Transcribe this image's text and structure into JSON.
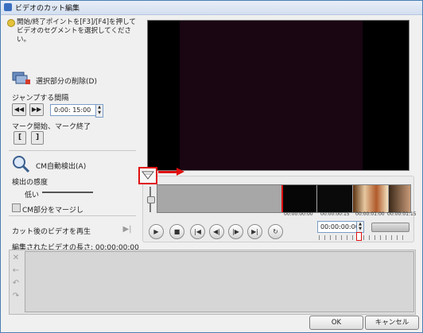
{
  "window": {
    "title": "ビデオのカット編集"
  },
  "hint": {
    "text": "開始/終了ポイントを[F3]/[F4]を押してビデオのセグメントを選択してください。"
  },
  "left": {
    "delete_selection_label": "選択部分の削除(D)",
    "jump_label": "ジャンプする間隔",
    "jump_time_value": "0:00: 15:00",
    "mark_label": "マーク開始、マーク終了",
    "mark_in": "[",
    "mark_out": "]",
    "cm_detect_label": "CM自動検出(A)",
    "sensitivity_label": "検出の感度",
    "sensitivity_low": "低い",
    "merge_cm_label": "CM部分をマージし",
    "play_cut_label": "カット後のビデオを再生",
    "length_label": "編集されたビデオの長さ: 00:00:00:00"
  },
  "timeline": {
    "timecodes": [
      "00:00:00:00",
      "00:00:00:15",
      "00:00:01:00",
      "00:00:01:15"
    ],
    "position": "00:00:00:00"
  },
  "buttons": {
    "ok": "OK",
    "cancel": "キャンセル"
  },
  "colors": {
    "marker_red": "#e01010",
    "title_bg": "#dbe5f3"
  }
}
